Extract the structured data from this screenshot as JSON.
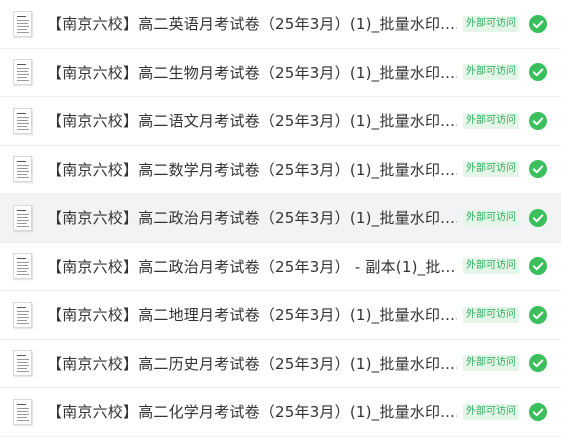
{
  "colors": {
    "badge_text": "#2fae5d",
    "badge_bg": "#e3f6e8",
    "check": "#3bbf5c",
    "selected_row_bg": "#f1f3f5"
  },
  "files": [
    {
      "name": "【南京六校】高二英语月考试卷（25年3月）(1)_批量水印....",
      "badge": "外部可访问",
      "status_icon": "check-circle-icon",
      "selected": false
    },
    {
      "name": "【南京六校】高二生物月考试卷（25年3月）(1)_批量水印....",
      "badge": "外部可访问",
      "status_icon": "check-circle-icon",
      "selected": false
    },
    {
      "name": "【南京六校】高二语文月考试卷（25年3月）(1)_批量水印....",
      "badge": "外部可访问",
      "status_icon": "check-circle-icon",
      "selected": false
    },
    {
      "name": "【南京六校】高二数学月考试卷（25年3月）(1)_批量水印....",
      "badge": "外部可访问",
      "status_icon": "check-circle-icon",
      "selected": false
    },
    {
      "name": "【南京六校】高二政治月考试卷（25年3月）(1)_批量水印....",
      "badge": "外部可访问",
      "status_icon": "check-circle-icon",
      "selected": true
    },
    {
      "name": "【南京六校】高二政治月考试卷（25年3月） - 副本(1)_批...",
      "badge": "外部可访问",
      "status_icon": "check-circle-icon",
      "selected": false
    },
    {
      "name": "【南京六校】高二地理月考试卷（25年3月）(1)_批量水印....",
      "badge": "外部可访问",
      "status_icon": "check-circle-icon",
      "selected": false
    },
    {
      "name": "【南京六校】高二历史月考试卷（25年3月）(1)_批量水印....",
      "badge": "外部可访问",
      "status_icon": "check-circle-icon",
      "selected": false
    },
    {
      "name": "【南京六校】高二化学月考试卷（25年3月）(1)_批量水印....",
      "badge": "外部可访问",
      "status_icon": "check-circle-icon",
      "selected": false
    }
  ]
}
